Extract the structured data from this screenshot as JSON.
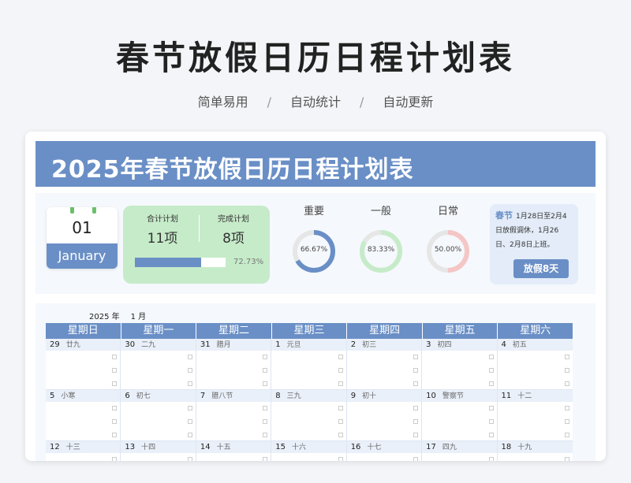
{
  "page": {
    "title": "春节放假日历日程计划表",
    "tags": [
      "简单易用",
      "自动统计",
      "自动更新"
    ]
  },
  "banner": {
    "title": "2025年春节放假日历日程计划表"
  },
  "month": {
    "number": "01",
    "name": "January"
  },
  "stats": {
    "total_label": "合计计划",
    "total_value": "11项",
    "done_label": "完成计划",
    "done_value": "8项",
    "progress_pct": 72.73,
    "progress_text": "72.73%"
  },
  "donuts": [
    {
      "label": "重要",
      "value": 66.67,
      "text": "66.67%",
      "color": "#6a8fc6"
    },
    {
      "label": "一般",
      "value": 83.33,
      "text": "83.33%",
      "color": "#c6ebc9"
    },
    {
      "label": "日常",
      "value": 50.0,
      "text": "50.00%",
      "color": "#f5c6c6"
    }
  ],
  "note": {
    "highlight": "春节",
    "text": "1月28日至2月4日放假调休，1月26日、2月8日上班。",
    "button": "放假8天"
  },
  "calendar": {
    "year": "2025 年",
    "month": "1  月",
    "weekdays": [
      "星期日",
      "星期一",
      "星期二",
      "星期三",
      "星期四",
      "星期五",
      "星期六"
    ],
    "days": [
      {
        "d": "29",
        "l": "廿九"
      },
      {
        "d": "30",
        "l": "二九"
      },
      {
        "d": "31",
        "l": "腊月"
      },
      {
        "d": "1",
        "l": "元旦"
      },
      {
        "d": "2",
        "l": "初三"
      },
      {
        "d": "3",
        "l": "初四"
      },
      {
        "d": "4",
        "l": "初五"
      },
      {
        "d": "5",
        "l": "小寒"
      },
      {
        "d": "6",
        "l": "初七"
      },
      {
        "d": "7",
        "l": "腊八节"
      },
      {
        "d": "8",
        "l": "三九"
      },
      {
        "d": "9",
        "l": "初十"
      },
      {
        "d": "10",
        "l": "警察节"
      },
      {
        "d": "11",
        "l": "十二"
      },
      {
        "d": "12",
        "l": "十三"
      },
      {
        "d": "13",
        "l": "十四"
      },
      {
        "d": "14",
        "l": "十五"
      },
      {
        "d": "15",
        "l": "十六"
      },
      {
        "d": "16",
        "l": "十七"
      },
      {
        "d": "17",
        "l": "四九"
      },
      {
        "d": "18",
        "l": "十九"
      }
    ]
  },
  "colors": {
    "accent": "#6a8fc6",
    "green": "#c6ebc9",
    "pink": "#f5c6c6"
  }
}
